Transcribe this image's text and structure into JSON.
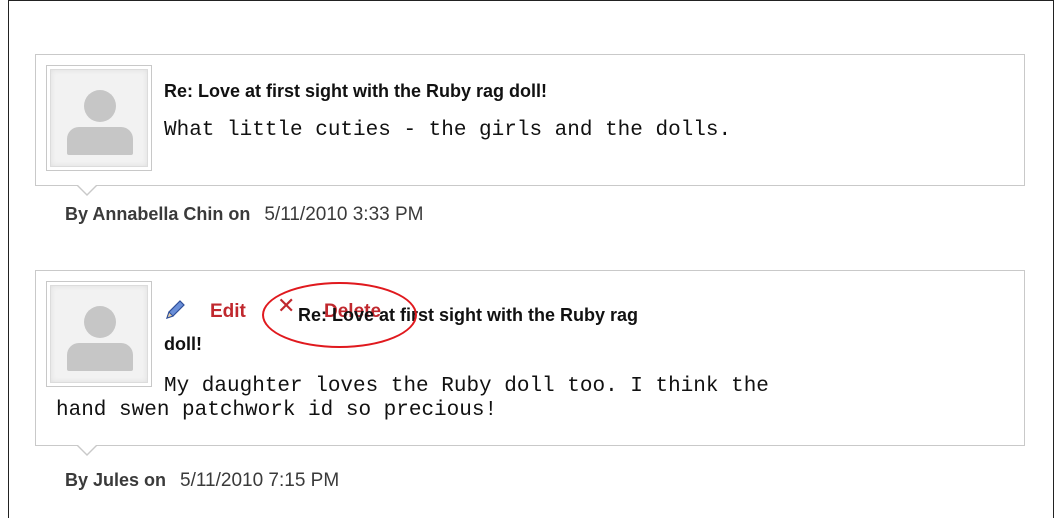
{
  "comments": [
    {
      "title": "Re: Love at first sight with the Ruby rag doll!",
      "body": "What little cuties - the girls and the dolls.",
      "author_label": "By Annabella Chin on",
      "date": "5/11/2010 3:33 PM"
    },
    {
      "actions": {
        "edit_label": "Edit",
        "delete_label": "Delete"
      },
      "title_part1": "Re: Love at first sight with the Ruby rag",
      "title_part2": "doll!",
      "body_line1": "My daughter loves the Ruby doll too. I think the",
      "body_line2": "hand swen patchwork id so precious!",
      "author_label": "By Jules on",
      "date": "5/11/2010 7:15 PM"
    }
  ],
  "colors": {
    "action": "#c0282e",
    "highlight": "#e0191e",
    "border": "#c9c9c9"
  },
  "icons": {
    "edit": "pencil-icon",
    "delete": "x-icon",
    "avatar": "user-placeholder-icon"
  }
}
